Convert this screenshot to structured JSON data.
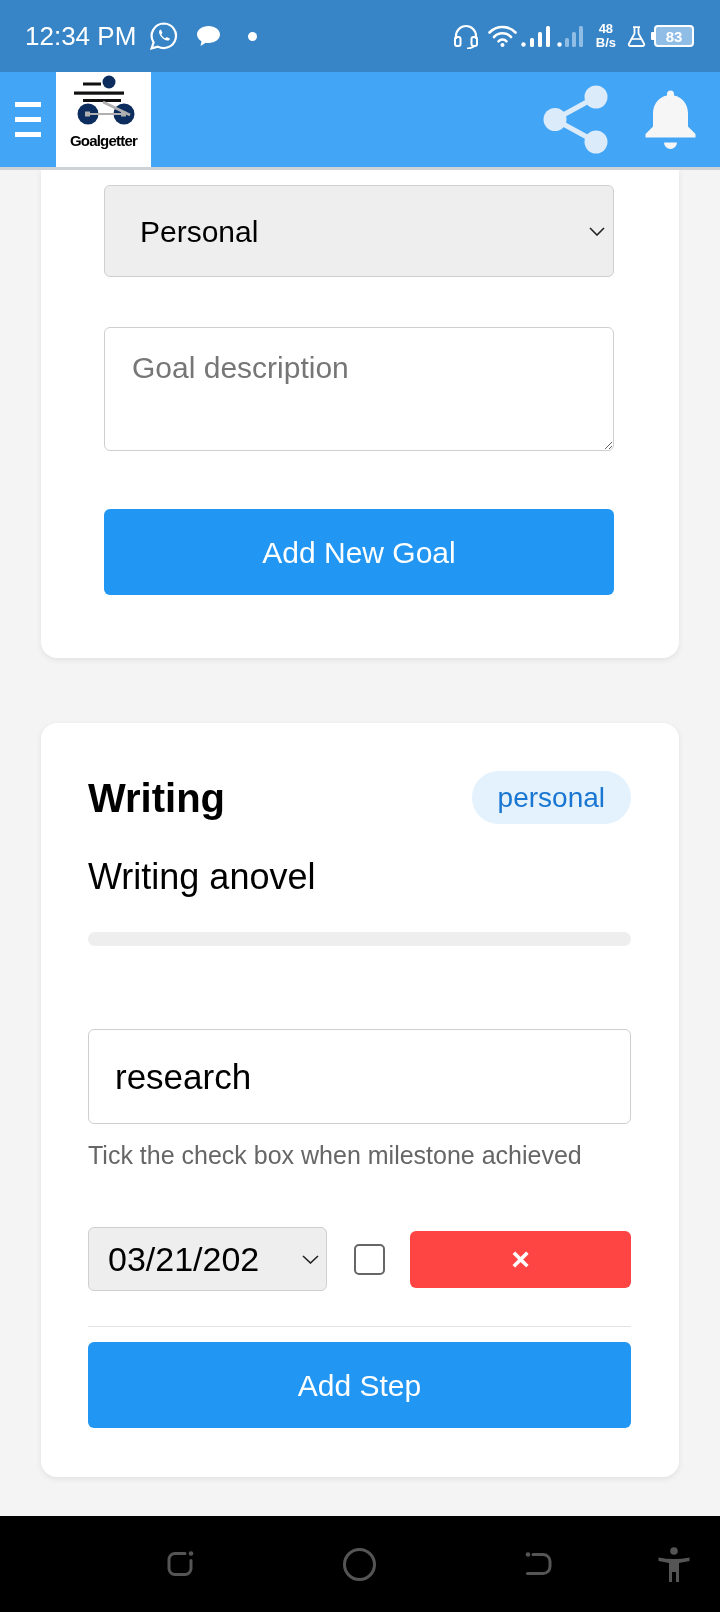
{
  "status_bar": {
    "time": "12:34 PM",
    "net_speed_value": "48",
    "net_speed_unit": "B/s",
    "battery": "83"
  },
  "app_bar": {
    "logo_text": "Goalgetter"
  },
  "goal_form": {
    "category": {
      "value": "Personal"
    },
    "description": {
      "placeholder": "Goal description"
    },
    "submit_button": "Add New Goal"
  },
  "goals": [
    {
      "title": "Writing",
      "category": "personal",
      "description": "Writing anovel",
      "steps": [
        {
          "name": "research",
          "hint": "Tick the check box when milestone achieved",
          "date": "03/21/202",
          "checked": false,
          "delete_button": "×"
        }
      ],
      "add_step_button": "Add Step"
    }
  ]
}
